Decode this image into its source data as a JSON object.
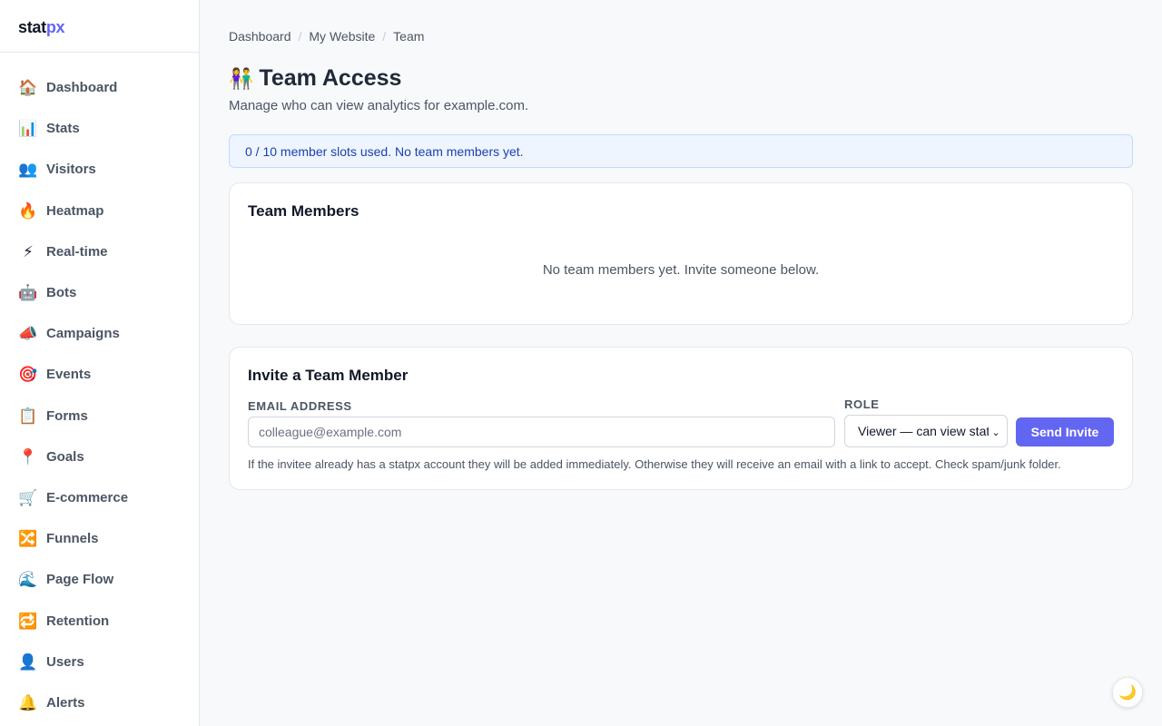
{
  "brand": {
    "part1": "stat",
    "part2": "px",
    "accent_color": "#6366f1"
  },
  "sidebar": {
    "items": [
      {
        "icon": "🏠",
        "icon_name": "house-icon",
        "label": "Dashboard"
      },
      {
        "icon": "📊",
        "icon_name": "bar-chart-icon",
        "label": "Stats"
      },
      {
        "icon": "👥",
        "icon_name": "users-icon",
        "label": "Visitors"
      },
      {
        "icon": "🔥",
        "icon_name": "fire-icon",
        "label": "Heatmap"
      },
      {
        "icon": "⚡",
        "icon_name": "lightning-icon",
        "label": "Real-time"
      },
      {
        "icon": "🤖",
        "icon_name": "robot-icon",
        "label": "Bots"
      },
      {
        "icon": "📣",
        "icon_name": "megaphone-icon",
        "label": "Campaigns"
      },
      {
        "icon": "🎯",
        "icon_name": "target-icon",
        "label": "Events"
      },
      {
        "icon": "📋",
        "icon_name": "clipboard-icon",
        "label": "Forms"
      },
      {
        "icon": "📍",
        "icon_name": "pin-icon",
        "label": "Goals"
      },
      {
        "icon": "🛒",
        "icon_name": "cart-icon",
        "label": "E-commerce"
      },
      {
        "icon": "🔀",
        "icon_name": "shuffle-icon",
        "label": "Funnels"
      },
      {
        "icon": "🌊",
        "icon_name": "wave-icon",
        "label": "Page Flow"
      },
      {
        "icon": "🔁",
        "icon_name": "repeat-icon",
        "label": "Retention"
      },
      {
        "icon": "👤",
        "icon_name": "user-icon",
        "label": "Users"
      },
      {
        "icon": "🔔",
        "icon_name": "bell-icon",
        "label": "Alerts"
      }
    ]
  },
  "breadcrumb": {
    "items": [
      "Dashboard",
      "My Website",
      "Team"
    ],
    "separator": "/"
  },
  "page": {
    "title_icon": "👫",
    "title": "Team Access",
    "subtitle": "Manage who can view analytics for example.com."
  },
  "banner": {
    "text": "0 / 10 member slots used. No team members yet."
  },
  "members": {
    "title": "Team Members",
    "empty_text": "No team members yet. Invite someone below."
  },
  "invite": {
    "title": "Invite a Team Member",
    "email_label": "Email Address",
    "email_placeholder": "colleague@example.com",
    "role_label": "Role",
    "role_value": "Viewer — can view stats",
    "role_chevron": "⌄",
    "send_label": "Send Invite",
    "helper": "If the invitee already has a statpx account they will be added immediately. Otherwise they will receive an email with a link to accept. Check spam/junk folder."
  },
  "theme_toggle": {
    "icon": "🌙",
    "icon_name": "moon-icon"
  }
}
